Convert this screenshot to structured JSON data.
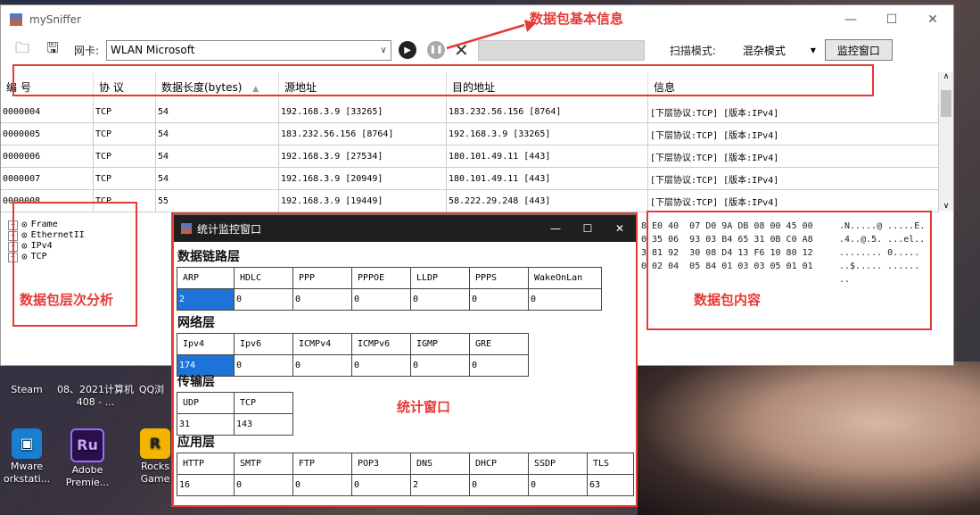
{
  "desktop": {
    "icons": [
      {
        "label": "Steam",
        "icon": "steam-icon"
      },
      {
        "label": "08、2021计算机408 - ...",
        "icon": "document-icon"
      },
      {
        "label": "QQ浏",
        "icon": "qq-browser-icon"
      },
      {
        "label": "Mware orkstati...",
        "icon": "vmware-icon"
      },
      {
        "label": "Adobe Premie...",
        "icon": "adobe-premiere-icon"
      },
      {
        "label": "Rocks Game",
        "icon": "rockstar-icon"
      }
    ]
  },
  "window": {
    "title": "mySniffer"
  },
  "toolbar": {
    "nic_label": "网卡:",
    "nic_value": "WLAN  Microsoft",
    "scan_label": "扫描模式:",
    "scan_mode": "混杂模式",
    "monitor_button": "监控窗口"
  },
  "grid": {
    "headers": [
      "编 号",
      "协 议",
      "数据长度(bytes)",
      "源地址",
      "目的地址",
      "信息"
    ],
    "rows": [
      [
        "0000004",
        "TCP",
        "54",
        "192.168.3.9 [33265]",
        "183.232.56.156 [8764]",
        "[下层协议:TCP] [版本:IPv4]"
      ],
      [
        "0000005",
        "TCP",
        "54",
        "183.232.56.156 [8764]",
        "192.168.3.9 [33265]",
        "[下层协议:TCP] [版本:IPv4]"
      ],
      [
        "0000006",
        "TCP",
        "54",
        "192.168.3.9 [27534]",
        "180.101.49.11 [443]",
        "[下层协议:TCP] [版本:IPv4]"
      ],
      [
        "0000007",
        "TCP",
        "54",
        "192.168.3.9 [20949]",
        "180.101.49.11 [443]",
        "[下层协议:TCP] [版本:IPv4]"
      ],
      [
        "0000008",
        "TCP",
        "55",
        "192.168.3.9 [19449]",
        "58.222.29.248 [443]",
        "[下层协议:TCP] [版本:IPv4]"
      ]
    ]
  },
  "tree": [
    "Frame",
    "EthernetII",
    "IPv4",
    "TCP"
  ],
  "hex": {
    "lines": [
      "8 E0 40  07 D0 9A DB 08 00 45 00",
      "0 35 06  93 03 B4 65 31 0B C0 A8",
      "3 81 92  30 08 D4 13 F6 10 80 12",
      "0 02 04  05 84 01 03 03 05 01 01"
    ],
    "ascii": [
      ".N.....@ .....E.",
      ".4..@.5. ...el..",
      "........ 0.....",
      "..$..... ......",
      ".."
    ]
  },
  "annotations": {
    "basic_info": "数据包基本信息",
    "layer_analysis": "数据包层次分析",
    "content": "数据包内容",
    "stats": "统计窗口"
  },
  "stats_window": {
    "title": "统计监控窗口",
    "datalink": {
      "title": "数据链路层",
      "headers": [
        "ARP",
        "HDLC",
        "PPP",
        "PPPOE",
        "LLDP",
        "PPPS",
        "WakeOnLan"
      ],
      "values": [
        "2",
        "0",
        "0",
        "0",
        "0",
        "0",
        "0"
      ]
    },
    "network": {
      "title": "网络层",
      "headers": [
        "Ipv4",
        "Ipv6",
        "ICMPv4",
        "ICMPv6",
        "IGMP",
        "GRE"
      ],
      "values": [
        "174",
        "0",
        "0",
        "0",
        "0",
        "0"
      ]
    },
    "transport": {
      "title": "传输层",
      "headers": [
        "UDP",
        "TCP"
      ],
      "values": [
        "31",
        "143"
      ]
    },
    "application": {
      "title": "应用层",
      "headers": [
        "HTTP",
        "SMTP",
        "FTP",
        "POP3",
        "DNS",
        "DHCP",
        "SSDP",
        "TLS"
      ],
      "values": [
        "16",
        "0",
        "0",
        "0",
        "2",
        "0",
        "0",
        "63"
      ]
    }
  }
}
